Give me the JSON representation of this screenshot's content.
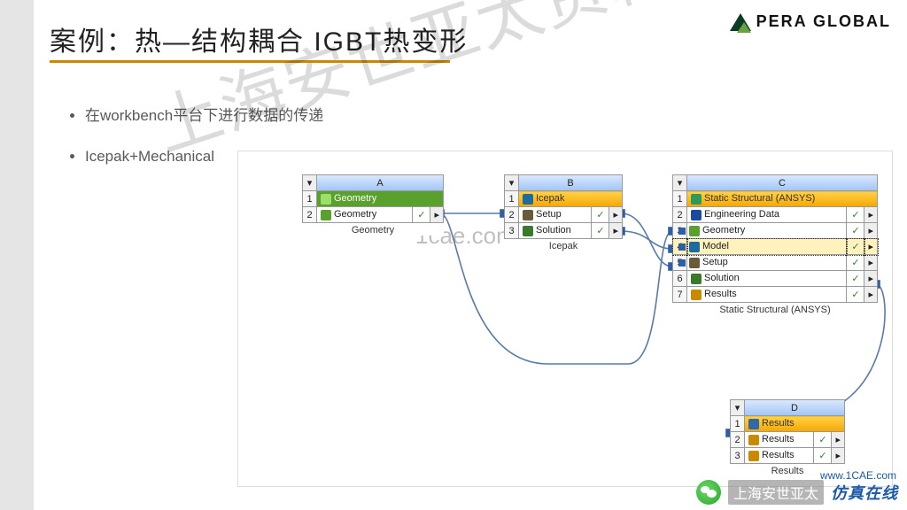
{
  "logo_text": "PERA GLOBAL",
  "title": "案例：热—结构耦合 IGBT热变形",
  "bullets": [
    "在workbench平台下进行数据的传递",
    "Icepak+Mechanical"
  ],
  "watermark_big": "上海安世亚太资料分享",
  "watermark_mid": "1cae.com",
  "blocks": {
    "A": {
      "letter": "A",
      "title": "Geometry",
      "title_color": "#5aa02c",
      "caption": "Geometry",
      "rows": [
        {
          "n": "1",
          "icon": "#5aa02c",
          "label": "Geometry",
          "chk": ""
        },
        {
          "n": "2",
          "icon": "#5aa02c",
          "label": "Geometry",
          "chk": "✓"
        }
      ]
    },
    "B": {
      "letter": "B",
      "title": "Icepak",
      "title_color": "#2e6aa8",
      "caption": "Icepak",
      "rows": [
        {
          "n": "1",
          "icon": "#1e6b9e",
          "label": "Icepak",
          "chk": ""
        },
        {
          "n": "2",
          "icon": "#6b5a3a",
          "label": "Setup",
          "chk": "✓"
        },
        {
          "n": "3",
          "icon": "#3a7a2a",
          "label": "Solution",
          "chk": "✓"
        }
      ]
    },
    "C": {
      "letter": "C",
      "title": "Static Structural (ANSYS)",
      "title_color": "#2e9a5a",
      "caption": "Static Structural (ANSYS)",
      "rows": [
        {
          "n": "1",
          "icon": "#2e9a5a",
          "label": "Static Structural (ANSYS)",
          "chk": ""
        },
        {
          "n": "2",
          "icon": "#1e4a9e",
          "label": "Engineering Data",
          "chk": "✓"
        },
        {
          "n": "3",
          "icon": "#5aa02c",
          "label": "Geometry",
          "chk": "✓"
        },
        {
          "n": "4",
          "icon": "#1e6b9e",
          "label": "Model",
          "chk": "✓"
        },
        {
          "n": "5",
          "icon": "#6b5a3a",
          "label": "Setup",
          "chk": "✓"
        },
        {
          "n": "6",
          "icon": "#3a7a2a",
          "label": "Solution",
          "chk": "✓"
        },
        {
          "n": "7",
          "icon": "#c98a00",
          "label": "Results",
          "chk": "✓"
        }
      ],
      "highlight_row": 4
    },
    "D": {
      "letter": "D",
      "title": "Results",
      "title_color": "#2e6aa8",
      "caption": "Results",
      "rows": [
        {
          "n": "1",
          "icon": "#2e6aa8",
          "label": "Results",
          "chk": ""
        },
        {
          "n": "2",
          "icon": "#c98a00",
          "label": "Results",
          "chk": "✓"
        },
        {
          "n": "3",
          "icon": "#c98a00",
          "label": "Results",
          "chk": "✓"
        }
      ]
    }
  },
  "connections": [
    {
      "from": "A.2",
      "to": "B.2"
    },
    {
      "from": "A.2",
      "to": "C.3"
    },
    {
      "from": "B.2",
      "to": "C.5"
    },
    {
      "from": "B.3",
      "to": "C.4"
    },
    {
      "from": "C.6",
      "to": "D.2"
    }
  ],
  "footer": {
    "url": "www.1CAE.com",
    "wx": "上海安世亚太",
    "brand": "仿真在线"
  }
}
